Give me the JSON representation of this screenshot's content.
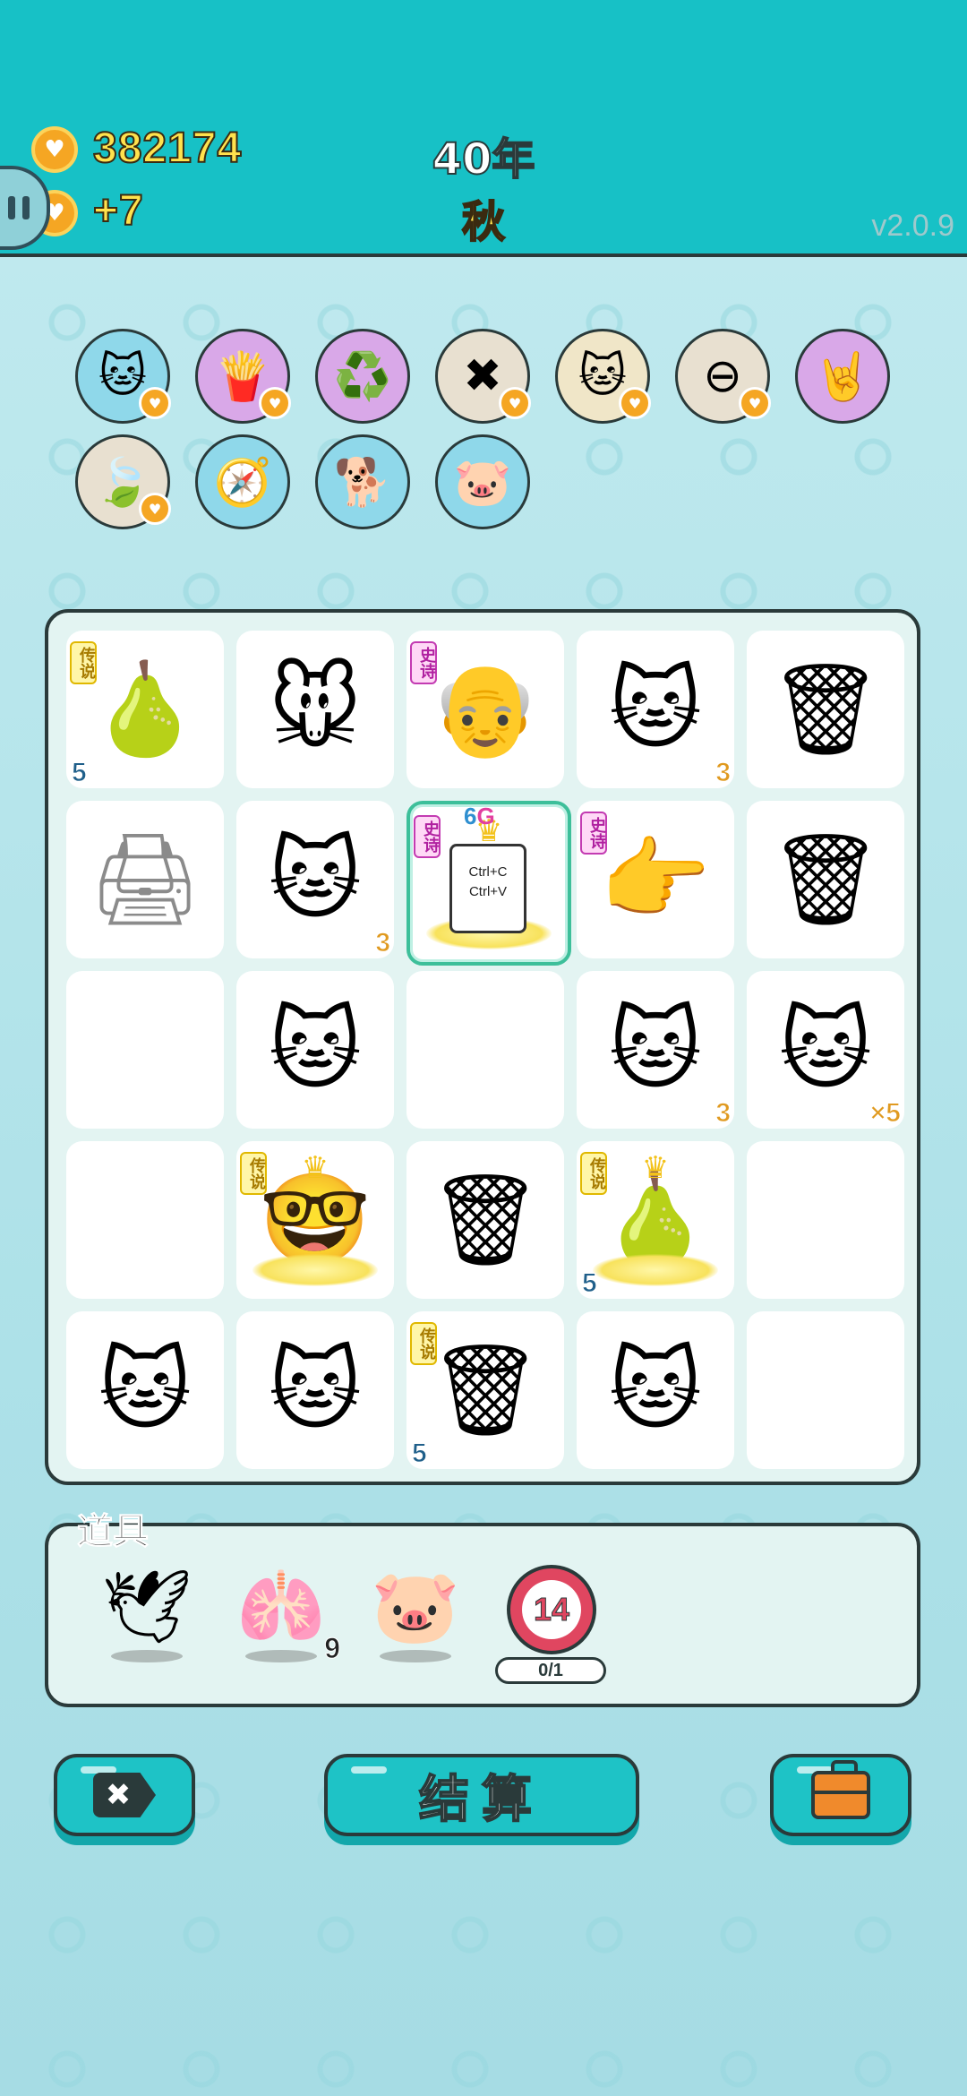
{
  "header": {
    "coins": "382174",
    "income": "+7",
    "year": "40年",
    "season": "秋",
    "version": "v2.0.9"
  },
  "buffs": [
    {
      "name": "cat-face-buff",
      "icon": "🐱",
      "bg": "#8fd8ea",
      "heart": true
    },
    {
      "name": "fries-buff",
      "icon": "🍟",
      "bg": "#d9a8e8",
      "heart": true
    },
    {
      "name": "recycle-buff",
      "icon": "♻️",
      "bg": "#d9a8e8",
      "heart": false
    },
    {
      "name": "remove-tag-buff",
      "icon": "✖",
      "bg": "#e8e0d0",
      "heart": true
    },
    {
      "name": "twin-cats-buff",
      "icon": "🐱",
      "bg": "#f0e6c8",
      "heart": true
    },
    {
      "name": "minus-buff",
      "icon": "⊖",
      "bg": "#e8e0d0",
      "heart": true
    },
    {
      "name": "rock-hand-buff",
      "icon": "🤘",
      "bg": "#d9a8e8",
      "heart": false
    },
    {
      "name": "leaf-buff",
      "icon": "🍃",
      "bg": "#e8e0d0",
      "heart": true
    },
    {
      "name": "compass-buff",
      "icon": "🧭",
      "bg": "#8fd8ea",
      "heart": false
    },
    {
      "name": "dog-buff",
      "icon": "🐕",
      "bg": "#8fd8ea",
      "heart": false
    },
    {
      "name": "piggy-buff",
      "icon": "🐷",
      "bg": "#8fd8ea",
      "heart": false
    }
  ],
  "board": [
    [
      {
        "icon": "🍐",
        "name": "pear",
        "tag": "传说",
        "tagType": "leg",
        "count": "5",
        "countPos": "bl"
      },
      {
        "icon": "🐭",
        "name": "mouse"
      },
      {
        "icon": "👴",
        "name": "bearded-man",
        "tag": "史诗",
        "tagType": "epic"
      },
      {
        "icon": "🐱",
        "name": "cat",
        "count": "3",
        "countPos": "br"
      },
      {
        "icon": "🗑",
        "name": "trash-bag"
      }
    ],
    [
      {
        "icon": "🖨",
        "name": "printer",
        "faded": true
      },
      {
        "icon": "🐱",
        "name": "cat",
        "count": "3",
        "countPos": "br"
      },
      {
        "icon": "",
        "name": "ctrl-cv-card",
        "tag": "史诗",
        "tagType": "epic",
        "paper": "Ctrl+C\nCtrl+V",
        "gsix": "6",
        "gletter": "G",
        "crown": true,
        "selected": true
      },
      {
        "icon": "👉",
        "name": "pointing-hand",
        "tag": "史诗",
        "tagType": "epic"
      },
      {
        "icon": "🗑",
        "name": "trash-bag"
      }
    ],
    [
      {
        "icon": "",
        "name": "empty"
      },
      {
        "icon": "🐱",
        "name": "cat"
      },
      {
        "icon": "",
        "name": "empty"
      },
      {
        "icon": "🐱",
        "name": "cat",
        "count": "3",
        "countPos": "br"
      },
      {
        "icon": "🐱",
        "name": "cat",
        "count": "×5",
        "countPos": "br"
      }
    ],
    [
      {
        "icon": "",
        "name": "empty"
      },
      {
        "icon": "🤓",
        "name": "crowned-grandpa",
        "tag": "传说",
        "tagType": "leg",
        "crown": true
      },
      {
        "icon": "🗑",
        "name": "trash-bag"
      },
      {
        "icon": "🍐",
        "name": "crowned-pear",
        "tag": "传说",
        "tagType": "leg",
        "crown": true,
        "count": "5",
        "countPos": "bl"
      },
      {
        "icon": "",
        "name": "empty"
      }
    ],
    [
      {
        "icon": "🐱",
        "name": "cat"
      },
      {
        "icon": "🐱",
        "name": "cat"
      },
      {
        "icon": "🗑",
        "name": "legendary-trash-bag",
        "tag": "传说",
        "tagType": "leg",
        "count": "5",
        "countPos": "bl"
      },
      {
        "icon": "🐱",
        "name": "cat"
      },
      {
        "icon": "",
        "name": "empty"
      }
    ]
  ],
  "items": {
    "title": "道具",
    "list": [
      {
        "name": "bird-item",
        "icon": "🕊"
      },
      {
        "name": "liver-item",
        "icon": "🫁",
        "count": "9"
      },
      {
        "name": "piggy-bank-item",
        "icon": "🐷"
      }
    ],
    "timer": {
      "value": "14",
      "progress": "0/1"
    }
  },
  "buttons": {
    "remove": "✖",
    "settle": "结算"
  }
}
